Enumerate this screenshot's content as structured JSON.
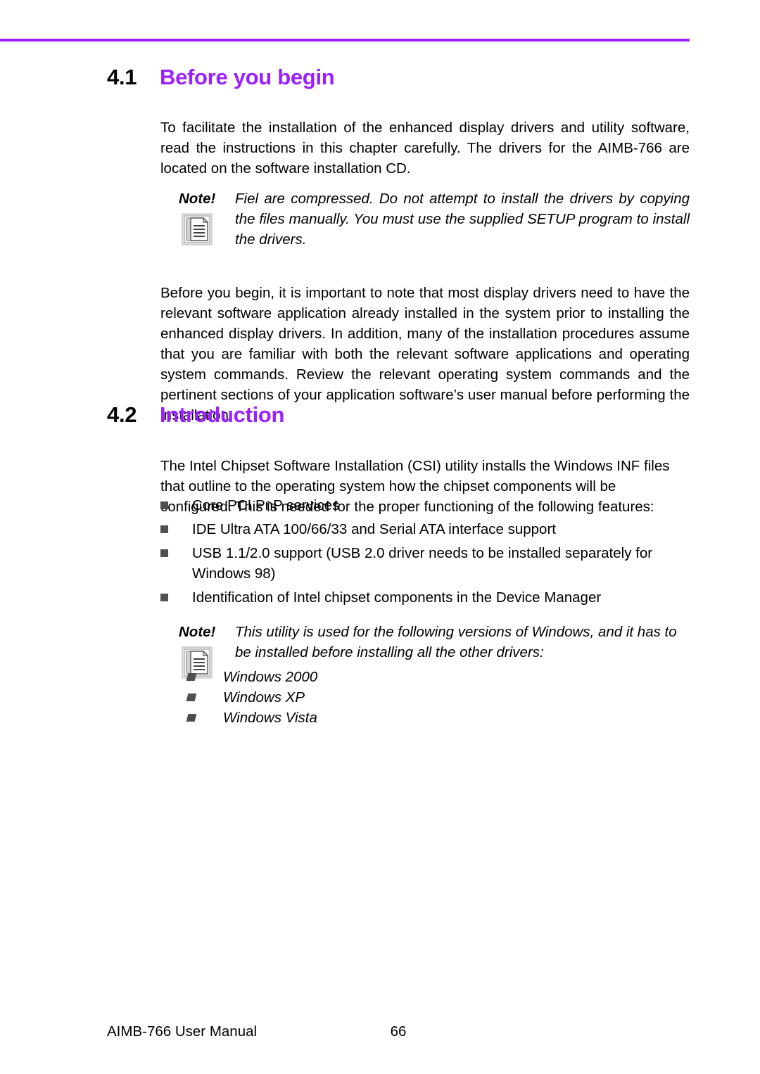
{
  "page": {
    "rule_color": "#9B1FFF",
    "accent_color": "#9B1FFF",
    "bullet_color": "#4f4f4f"
  },
  "sections": [
    {
      "number": "4.1",
      "title": "Before you begin",
      "paragraph": "To facilitate the installation of the enhanced display drivers and utility software, read the instructions in this chapter carefully. The drivers for the AIMB-766 are located on the software installation CD.",
      "paragraph2": "Before you begin, it is important to note that most display drivers need to have the relevant software application already installed in the system prior to installing the enhanced display drivers. In addition, many of the installation procedures assume that you are familiar with both the relevant software applications and operating system commands. Review the relevant operating system commands and the pertinent sections of your application software’s user manual before performing the installation."
    },
    {
      "number": "4.2",
      "title": "Introduction",
      "paragraph": "The Intel Chipset Software Installation (CSI) utility installs the Windows INF files that outline to the operating system how the chipset components will be configured. This is needed for the proper functioning of the following features:"
    }
  ],
  "feature_bullets": [
    "Core PCI PnP services",
    "IDE Ultra ATA 100/66/33 and Serial ATA interface support",
    "USB 1.1/2.0 support (USB 2.0 driver needs to be installed separately for Windows 98)",
    "Identification of Intel chipset components in the Device Manager"
  ],
  "notes": [
    {
      "label": "Note!",
      "icon": "note-document-icon",
      "text": "Fiel are compressed. Do not attempt to install the drivers by copying the files manually. You must use the supplied SETUP program to install the drivers.",
      "sublist": []
    },
    {
      "label": "Note!",
      "icon": "note-document-icon",
      "text": "This utility is used for the following versions of Windows, and it has to be installed before installing all the other drivers:",
      "sublist": [
        "Windows 2000",
        "Windows XP",
        "Windows Vista"
      ]
    }
  ],
  "footer": {
    "manual_title": "AIMB-766 User Manual",
    "page_number": "66"
  }
}
